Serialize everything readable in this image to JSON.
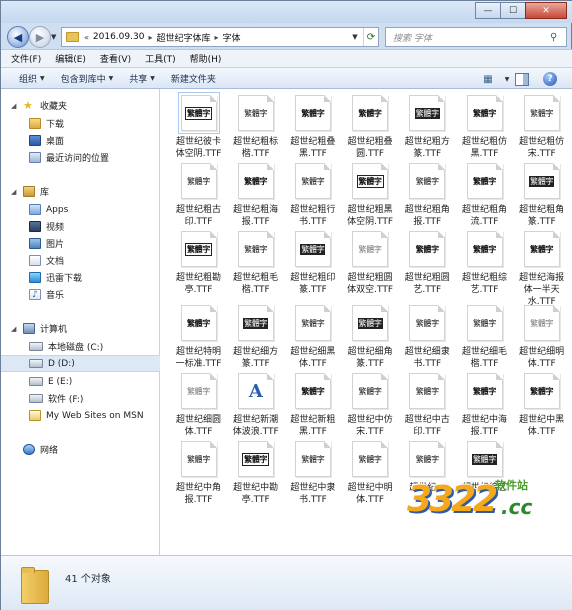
{
  "window": {
    "controls": {
      "minimize": "—",
      "maximize": "☐",
      "close": "✕"
    }
  },
  "address": {
    "overflow": "«",
    "crumbs": [
      "2016.09.30",
      "超世纪字体库",
      "字体"
    ],
    "separator": "▸",
    "search_placeholder": "搜索 字体"
  },
  "menu": [
    "文件(F)",
    "编辑(E)",
    "查看(V)",
    "工具(T)",
    "帮助(H)"
  ],
  "toolbar": {
    "organize": "组织",
    "include_in_library": "包含到库中",
    "share": "共享",
    "new_folder": "新建文件夹",
    "help": "?"
  },
  "nav": {
    "favorites_header": "收藏夹",
    "favorites": [
      "下载",
      "桌面",
      "最近访问的位置"
    ],
    "libraries_header": "库",
    "libraries": [
      "Apps",
      "视频",
      "图片",
      "文档",
      "迅雷下载",
      "音乐"
    ],
    "computer_header": "计算机",
    "drives": [
      "本地磁盘 (C:)",
      "D (D:)",
      "E (E:)",
      "软件 (F:)",
      "My Web Sites on MSN"
    ],
    "network": "网络"
  },
  "files": [
    {
      "line1": "超世纪彼卡",
      "line2": "体空阴.TTF",
      "glyph": "繁體字",
      "style": "stamp"
    },
    {
      "line1": "超世纪粗标",
      "line2": "楷.TTF",
      "glyph": "繁體字",
      "style": "plain"
    },
    {
      "line1": "超世纪粗叠",
      "line2": "黑.TTF",
      "glyph": "繁體字",
      "style": "bold"
    },
    {
      "line1": "超世纪粗叠",
      "line2": "圆.TTF",
      "glyph": "繁體字",
      "style": "bold"
    },
    {
      "line1": "超世纪粗方",
      "line2": "篆.TTF",
      "glyph": "繁體字",
      "style": "inv"
    },
    {
      "line1": "超世纪粗仿",
      "line2": "黑.TTF",
      "glyph": "繁體字",
      "style": "bold"
    },
    {
      "line1": "超世纪粗仿",
      "line2": "宋.TTF",
      "glyph": "繁體字",
      "style": "plain"
    },
    {
      "line1": "超世纪粗古",
      "line2": "印.TTF",
      "glyph": "繁體字",
      "style": "plain"
    },
    {
      "line1": "超世纪粗海",
      "line2": "报.TTF",
      "glyph": "繁體字",
      "style": "bold"
    },
    {
      "line1": "超世纪粗行",
      "line2": "书.TTF",
      "glyph": "繁體字",
      "style": "plain"
    },
    {
      "line1": "超世纪粗黑",
      "line2": "体空阴.TTF",
      "glyph": "繁體字",
      "style": "stamp"
    },
    {
      "line1": "超世纪粗角",
      "line2": "报.TTF",
      "glyph": "繁體字",
      "style": "plain"
    },
    {
      "line1": "超世纪粗角",
      "line2": "流.TTF",
      "glyph": "繁體字",
      "style": "bold"
    },
    {
      "line1": "超世纪粗角",
      "line2": "篆.TTF",
      "glyph": "繁體字",
      "style": "inv"
    },
    {
      "line1": "超世纪粗勘",
      "line2": "亭.TTF",
      "glyph": "繁體字",
      "style": "stamp"
    },
    {
      "line1": "超世纪粗毛",
      "line2": "楷.TTF",
      "glyph": "繁體字",
      "style": "plain"
    },
    {
      "line1": "超世纪粗印",
      "line2": "篆.TTF",
      "glyph": "繁體字",
      "style": "inv"
    },
    {
      "line1": "超世纪粗圆",
      "line2": "体双空.TTF",
      "glyph": "繁體字",
      "style": "gray"
    },
    {
      "line1": "超世纪粗圆",
      "line2": "艺.TTF",
      "glyph": "繁體字",
      "style": "bold"
    },
    {
      "line1": "超世纪粗综",
      "line2": "艺.TTF",
      "glyph": "繁體字",
      "style": "bold"
    },
    {
      "line1": "超世纪海报",
      "line2": "体一半天",
      "line3": "水.TTF",
      "glyph": "繁體字",
      "style": "bold"
    },
    {
      "line1": "超世纪特明",
      "line2": "一标准.TTF",
      "glyph": "繁體字",
      "style": "bold"
    },
    {
      "line1": "超世纪细方",
      "line2": "篆.TTF",
      "glyph": "繁體字",
      "style": "inv"
    },
    {
      "line1": "超世纪细黑",
      "line2": "体.TTF",
      "glyph": "繁體字",
      "style": "plain"
    },
    {
      "line1": "超世纪细角",
      "line2": "篆.TTF",
      "glyph": "繁體字",
      "style": "inv"
    },
    {
      "line1": "超世纪细隶",
      "line2": "书.TTF",
      "glyph": "繁體字",
      "style": "plain"
    },
    {
      "line1": "超世纪细毛",
      "line2": "楷.TTF",
      "glyph": "繁體字",
      "style": "plain"
    },
    {
      "line1": "超世纪细明",
      "line2": "体.TTF",
      "glyph": "繁體字",
      "style": "gray"
    },
    {
      "line1": "超世纪细圆",
      "line2": "体.TTF",
      "glyph": "繁體字",
      "style": "gray"
    },
    {
      "line1": "超世纪新潮",
      "line2": "体波浪.TTF",
      "glyph": "A",
      "style": "bigA"
    },
    {
      "line1": "超世纪新粗",
      "line2": "黑.TTF",
      "glyph": "繁體字",
      "style": "bold"
    },
    {
      "line1": "超世纪中仿",
      "line2": "宋.TTF",
      "glyph": "繁體字",
      "style": "plain"
    },
    {
      "line1": "超世纪中古",
      "line2": "印.TTF",
      "glyph": "繁體字",
      "style": "plain"
    },
    {
      "line1": "超世纪中海",
      "line2": "报.TTF",
      "glyph": "繁體字",
      "style": "bold"
    },
    {
      "line1": "超世纪中黑",
      "line2": "体.TTF",
      "glyph": "繁體字",
      "style": "bold"
    },
    {
      "line1": "超世纪中角",
      "line2": "报.TTF",
      "glyph": "繁體字",
      "style": "plain"
    },
    {
      "line1": "超世纪中勘",
      "line2": "亭.TTF",
      "glyph": "繁體字",
      "style": "stamp"
    },
    {
      "line1": "超世纪中隶",
      "line2": "书.TTF",
      "glyph": "繁體字",
      "style": "plain"
    },
    {
      "line1": "超世纪中明",
      "line2": "体.TTF",
      "glyph": "繁體字",
      "style": "plain"
    },
    {
      "line1": "超世纪一",
      "line2": "",
      "glyph": "繁體字",
      "style": "plain"
    },
    {
      "line1": "超世纪综艺",
      "line2": "",
      "glyph": "繁體字",
      "style": "inv"
    }
  ],
  "watermark": {
    "number": "3322",
    "tld": ".cc",
    "site": "软件站"
  },
  "status": {
    "count_text": "41 个对象"
  }
}
